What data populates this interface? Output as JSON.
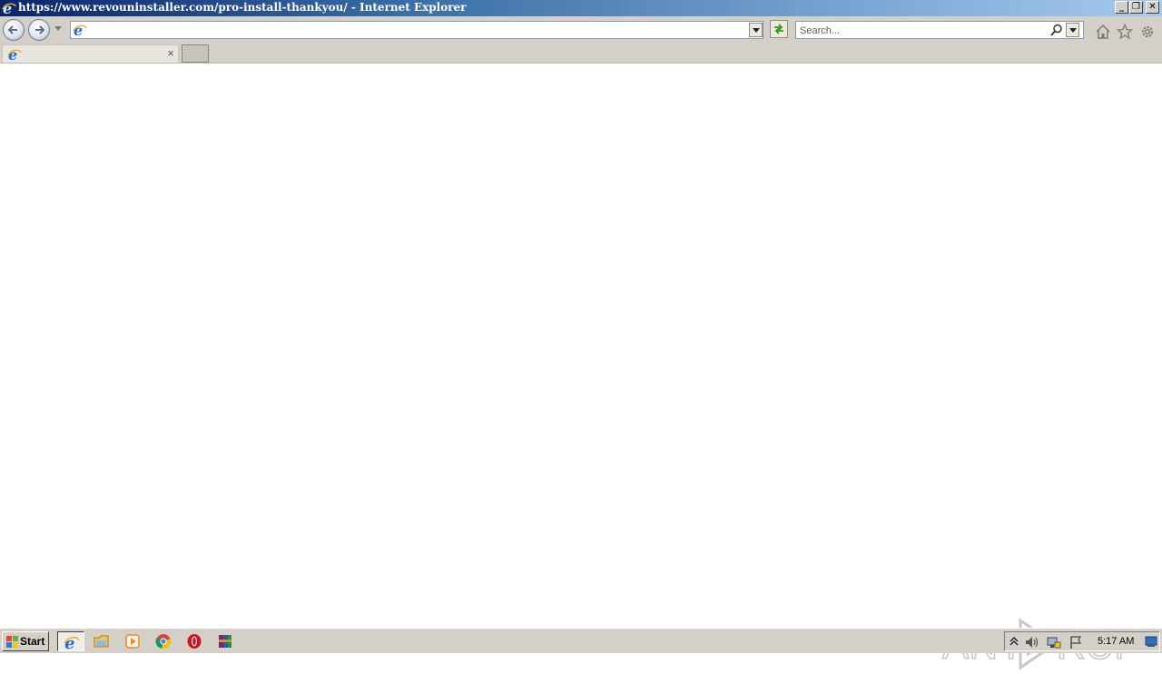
{
  "window": {
    "title": "https://www.revouninstaller.com/pro-install-thankyou/ - Internet Explorer",
    "minimize_label": "_",
    "restore_label": "❐",
    "close_label": "✕"
  },
  "toolbar": {
    "address_value": "",
    "search_placeholder": "Search..."
  },
  "tabs": [
    {
      "label": "",
      "close_label": "×"
    }
  ],
  "watermark": {
    "text": "ANY RUN"
  },
  "taskbar": {
    "start_label": "Start",
    "apps": [
      "internet-explorer",
      "file-explorer",
      "media-player",
      "chrome",
      "opera",
      "winrar"
    ],
    "clock": "5:17 AM"
  },
  "colors": {
    "titlebar_start": "#0a246a",
    "titlebar_end": "#a6caf0",
    "chrome_gray": "#d4d0c8",
    "ie_blue": "#1e6fd9",
    "ie_gold": "#f2b41c"
  }
}
